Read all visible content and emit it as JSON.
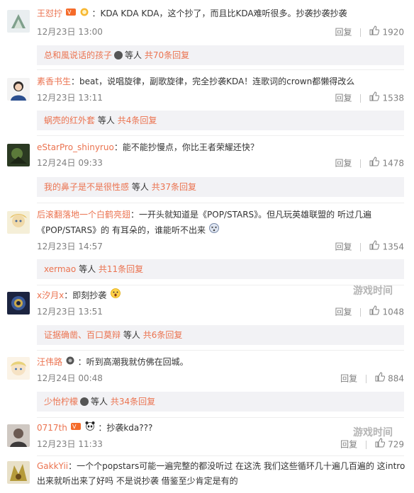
{
  "comments": [
    {
      "username": "王怼拧",
      "text": "：KDA KDA KDA，这个抄了，而且比KDA难听很多。抄袭抄袭抄袭",
      "date": "12月23日 13:00",
      "reply_label": "回复",
      "likes": "1920",
      "reply_summary": {
        "name": "总和風说话的孩子",
        "middle": "等人",
        "count": "共70条回复"
      }
    },
    {
      "username": "素香书生",
      "text": "：beat，说唱旋律，副歌旋律，完全抄袭KDA！连歌词的crown都懒得改么",
      "date": "12月23日 13:11",
      "reply_label": "回复",
      "likes": "1538",
      "reply_summary": {
        "name": "蜗壳的红外套",
        "middle": "等人",
        "count": "共4条回复"
      }
    },
    {
      "username": "eStarPro_shinyruo",
      "text": "：能不能抄慢点，你比王者荣耀还快？",
      "date": "12月24日 09:33",
      "reply_label": "回复",
      "likes": "1478",
      "reply_summary": {
        "name": "我的鼻子是不是很性感",
        "middle": "等人",
        "count": "共37条回复"
      }
    },
    {
      "username": "后滚翻落地一个白鹤亮翅",
      "text": "：一开头就知道是《POP/STARS》。但凡玩英雄联盟的 听过几遍",
      "text2": "《POP/STARS》的 有耳朵的，谁能听不出来",
      "date": "12月23日 14:57",
      "reply_label": "回复",
      "likes": "1354",
      "reply_summary": {
        "name": "xermao",
        "middle": "等人",
        "count": "共11条回复"
      }
    },
    {
      "username": "x汐月x",
      "text": "：即刻抄袭",
      "date": "12月23日 13:51",
      "reply_label": "回复",
      "likes": "1048",
      "reply_summary": {
        "name": "证据确凿、百口莫辩",
        "middle": "等人",
        "count": "共6条回复"
      }
    },
    {
      "username": "汪伟路",
      "text": "：听到高潮我就仿佛在回城。",
      "date": "12月24日 00:48",
      "reply_label": "回复",
      "likes": "884",
      "reply_summary": {
        "name": "少怡柠檬",
        "middle": "等人",
        "count": "共34条回复"
      }
    },
    {
      "username": "0717th",
      "text": "：抄袭kda???",
      "date": "12月23日 11:33",
      "reply_label": "回复",
      "likes": "729"
    },
    {
      "username": "GakkYii",
      "text": "：一个个popstars可能一遍完整的都没听过 在这洗 我们这些循环几十遍几百遍的 这intro",
      "text2": "出来就听出来了好吗  不是说抄袭 借鉴至少肯定是有的"
    }
  ],
  "watermark": "游戏时间",
  "colors": {
    "name": "#eb7350",
    "reply_bg": "#f2f2f5",
    "meta": "#808080"
  }
}
